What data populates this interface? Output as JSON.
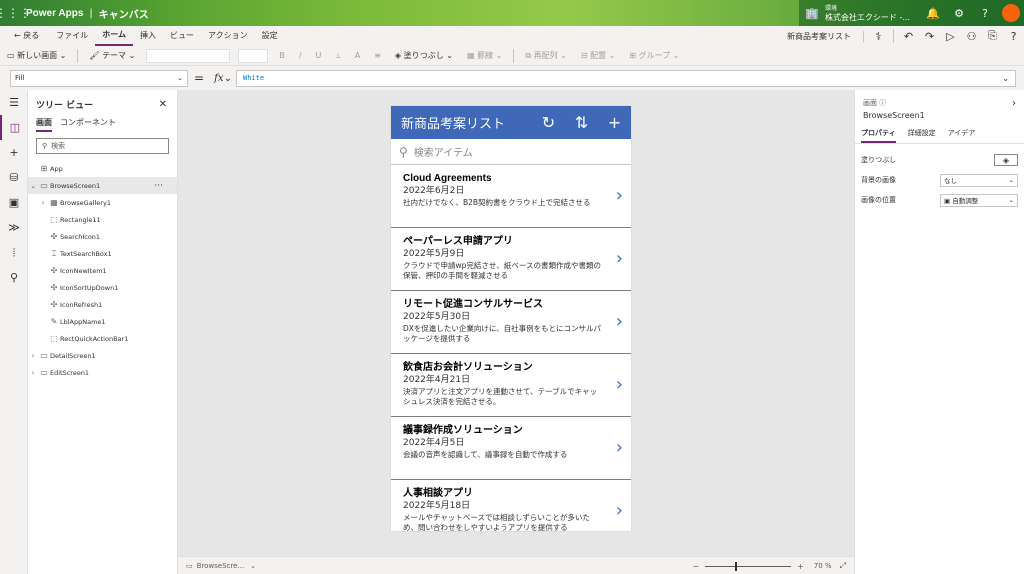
{
  "titlebar": {
    "app_name": "Power Apps",
    "separator": "|",
    "mode": "キャンバス",
    "env_label": "環境",
    "env_name": "株式会社エクシード -..."
  },
  "menu": {
    "back": "戻る",
    "items": [
      "ファイル",
      "ホーム",
      "挿入",
      "ビュー",
      "アクション",
      "設定"
    ],
    "active_index": 1,
    "app_title": "新商品考案リスト"
  },
  "ribbon": {
    "new_screen": "新しい画面",
    "theme": "テーマ",
    "bold": "B",
    "italic": "/",
    "underline": "U",
    "font_color": "A",
    "fill": "塗りつぶし",
    "border": "罫線",
    "reorder": "再配列",
    "align": "配置",
    "group": "グループ"
  },
  "formula": {
    "property": "Fill",
    "equals": "=",
    "fx": "fx",
    "value": "White"
  },
  "tree": {
    "title": "ツリー ビュー",
    "tabs": [
      "画面",
      "コンポーネント"
    ],
    "search_placeholder": "検索",
    "nodes": {
      "app": "App",
      "browse_screen": "BrowseScreen1",
      "browse_gallery": "BrowseGallery1",
      "rectangle": "Rectangle11",
      "search_icon": "SearchIcon1",
      "text_search": "TextSearchBox1",
      "icon_new": "IconNewItem1",
      "icon_sort": "IconSortUpDown1",
      "icon_refresh": "IconRefresh1",
      "lbl_app": "LblAppName1",
      "rect_quick": "RectQuickActionBar1",
      "detail_screen": "DetailScreen1",
      "edit_screen": "EditScreen1"
    }
  },
  "phone": {
    "title": "新商品考案リスト",
    "search_placeholder": "検索アイテム",
    "items": [
      {
        "title": "Cloud Agreements",
        "date": "2022年6月2日",
        "desc": "社内だけでなく、B2B契約書をクラウド上で完結させる"
      },
      {
        "title": "ペーパーレス申請アプリ",
        "date": "2022年5月9日",
        "desc": "クラウドで申請wp完結させ、紙ベースの書類作成や書類の保管、押印の手間を軽減させる"
      },
      {
        "title": "リモート促進コンサルサービス",
        "date": "2022年5月30日",
        "desc": "DXを促進したい企業向けに、自社事例をもとにコンサルパッケージを提供する"
      },
      {
        "title": "飲食店お会計ソリューション",
        "date": "2022年4月21日",
        "desc": "決済アプリと注文アプリを連動させて、テーブルでキャッシュレス決済を完結させる。"
      },
      {
        "title": "議事録作成ソリューション",
        "date": "2022年4月5日",
        "desc": "会議の音声を認識して、議事録を自動で作成する"
      },
      {
        "title": "人事相談アプリ",
        "date": "2022年5月18日",
        "desc": "メールやチャットベースでは相談しずらいことが多いため、問い合わせをしやすいようアプリを提供する"
      }
    ]
  },
  "bottom": {
    "screen": "BrowseScre...",
    "zoom_minus": "−",
    "zoom_plus": "+",
    "zoom_value": "70 %",
    "zoom_fraction": 0.35
  },
  "props": {
    "section": "画面",
    "name": "BrowseScreen1",
    "tabs": [
      "プロパティ",
      "詳細設定",
      "アイデア"
    ],
    "fill_label": "塗りつぶし",
    "bg_image_label": "背景の画像",
    "bg_image_value": "なし",
    "image_pos_label": "画像の位置",
    "image_pos_value": "自動調整"
  },
  "colors": {
    "accent": "#742774",
    "header_blue": "#3f69b8"
  }
}
